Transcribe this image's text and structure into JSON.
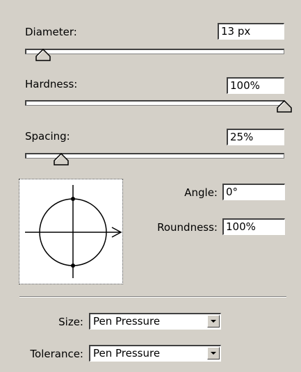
{
  "diameter": {
    "label": "Diameter:",
    "value": "13 px",
    "slider_fraction": 0.05
  },
  "hardness": {
    "label": "Hardness:",
    "value": "100%",
    "slider_fraction": 1.0
  },
  "spacing": {
    "label": "Spacing:",
    "value": "25%",
    "slider_fraction": 0.12
  },
  "angle": {
    "label": "Angle:",
    "value": "0°"
  },
  "roundness": {
    "label": "Roundness:",
    "value": "100%"
  },
  "size": {
    "label": "Size:",
    "value": "Pen Pressure"
  },
  "tolerance": {
    "label": "Tolerance:",
    "value": "Pen Pressure"
  },
  "icons": {
    "thumb": "triangle-slider-thumb",
    "preview": "brush-angle-preview",
    "dropdown": "chevron-down-icon"
  }
}
